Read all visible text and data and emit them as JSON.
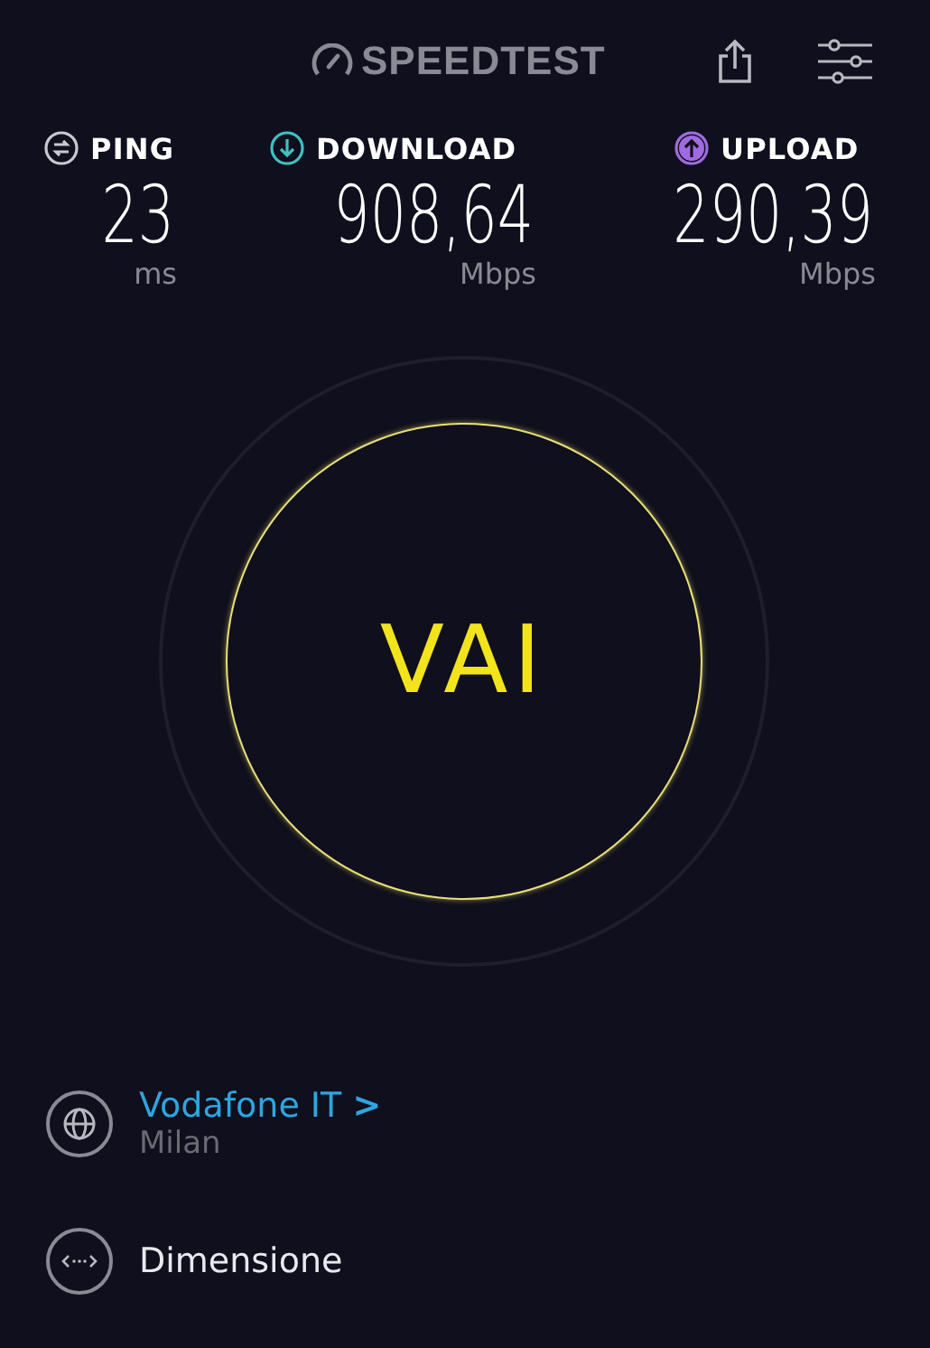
{
  "header": {
    "logo": "SPEEDTEST"
  },
  "metrics": [
    {
      "kind": "ping",
      "label": "PING",
      "value": "23",
      "unit": "ms"
    },
    {
      "kind": "download",
      "label": "DOWNLOAD",
      "value": "908,64",
      "unit": "Mbps"
    },
    {
      "kind": "upload",
      "label": "UPLOAD",
      "value": "290,39",
      "unit": "Mbps"
    }
  ],
  "go_button": {
    "label": "VAI"
  },
  "server": {
    "provider": "Vodafone IT",
    "chevron": ">",
    "location": "Milan"
  },
  "size": {
    "label": "Dimensione"
  }
}
